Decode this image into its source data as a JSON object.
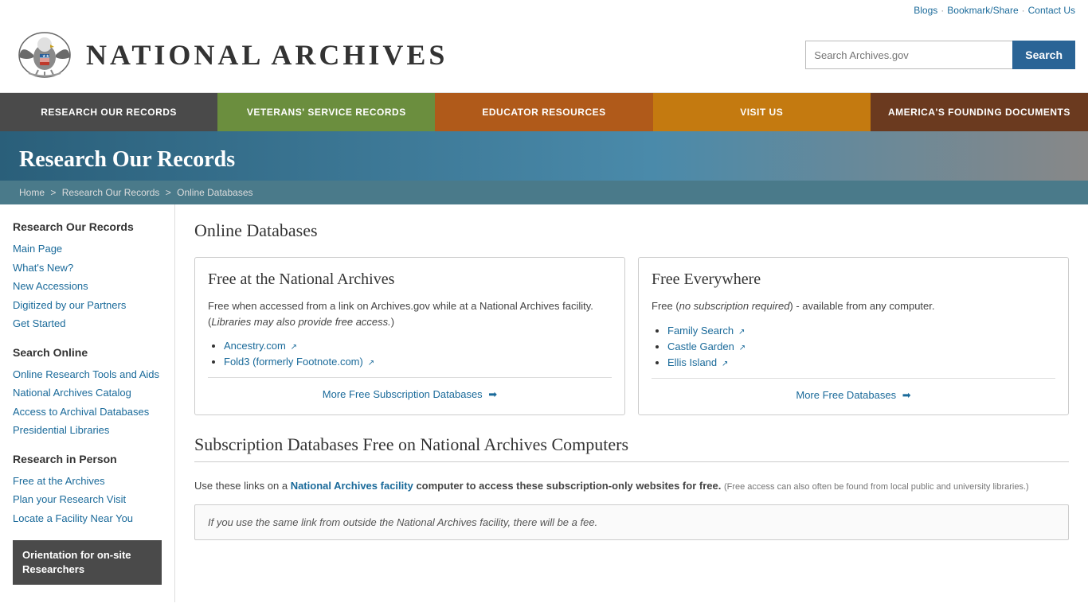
{
  "topbar": {
    "blogs": "Blogs",
    "bookmark": "Bookmark/Share",
    "contact": "Contact Us"
  },
  "header": {
    "logo_text": "NATIONAL ARCHIVES",
    "search_placeholder": "Search Archives.gov",
    "search_btn": "Search"
  },
  "nav": {
    "items": [
      {
        "id": "research",
        "label": "RESEARCH OUR RECORDS",
        "class": "nav-research"
      },
      {
        "id": "veterans",
        "label": "VETERANS' SERVICE RECORDS",
        "class": "nav-veterans"
      },
      {
        "id": "educator",
        "label": "EDUCATOR RESOURCES",
        "class": "nav-educator"
      },
      {
        "id": "visit",
        "label": "VISIT US",
        "class": "nav-visit"
      },
      {
        "id": "founding",
        "label": "AMERICA'S FOUNDING DOCUMENTS",
        "class": "nav-founding"
      }
    ]
  },
  "page_header": {
    "title": "Research Our Records"
  },
  "breadcrumb": {
    "home": "Home",
    "section": "Research Our Records",
    "current": "Online Databases"
  },
  "sidebar": {
    "section1_title": "Research Our Records",
    "section1_links": [
      {
        "label": "Main Page",
        "href": "#"
      },
      {
        "label": "What's New?",
        "href": "#"
      },
      {
        "label": "New Accessions",
        "href": "#"
      },
      {
        "label": "Digitized by our Partners",
        "href": "#"
      },
      {
        "label": "Get Started",
        "href": "#"
      }
    ],
    "section2_title": "Search Online",
    "section2_links": [
      {
        "label": "Online Research Tools and Aids",
        "href": "#"
      },
      {
        "label": "National Archives Catalog",
        "href": "#"
      },
      {
        "label": "Access to Archival Databases",
        "href": "#"
      },
      {
        "label": "Presidential Libraries",
        "href": "#"
      }
    ],
    "section3_title": "Research in Person",
    "section3_links": [
      {
        "label": "Free at the Archives",
        "href": "#"
      },
      {
        "label": "Plan your Research Visit",
        "href": "#"
      },
      {
        "label": "Locate a Facility Near You",
        "href": "#"
      }
    ],
    "orientation_label": "Orientation for on-site Researchers"
  },
  "content": {
    "page_title": "Online Databases",
    "card1": {
      "title": "Free at the National Archives",
      "description": "Free when accessed from a link on Archives.gov while at a National Archives facility. (",
      "description_italic": "Libraries may also provide free access.",
      "description_end": ")",
      "links": [
        {
          "label": "Ancestry.com",
          "href": "#"
        },
        {
          "label": "Fold3 (formerly Footnote.com)",
          "href": "#"
        }
      ],
      "footer_link": "More Free Subscription Databases"
    },
    "card2": {
      "title": "Free Everywhere",
      "description_start": "Free (",
      "description_italic": "no subscription required",
      "description_end": ") - available from any computer.",
      "links": [
        {
          "label": "Family Search",
          "href": "#"
        },
        {
          "label": "Castle Garden",
          "href": "#"
        },
        {
          "label": "Ellis Island",
          "href": "#"
        }
      ],
      "footer_link": "More Free Databases"
    },
    "subscription_title": "Subscription Databases Free on National Archives Computers",
    "subscription_desc1": "Use these links on a ",
    "subscription_link_text": "National Archives facility",
    "subscription_desc2": " computer to access these subscription-only websites for free.",
    "subscription_small": "(Free access can also often be found from local public and university libraries.)",
    "warning_text": "If you use the same link from outside the National Archives facility, there will be a fee."
  }
}
